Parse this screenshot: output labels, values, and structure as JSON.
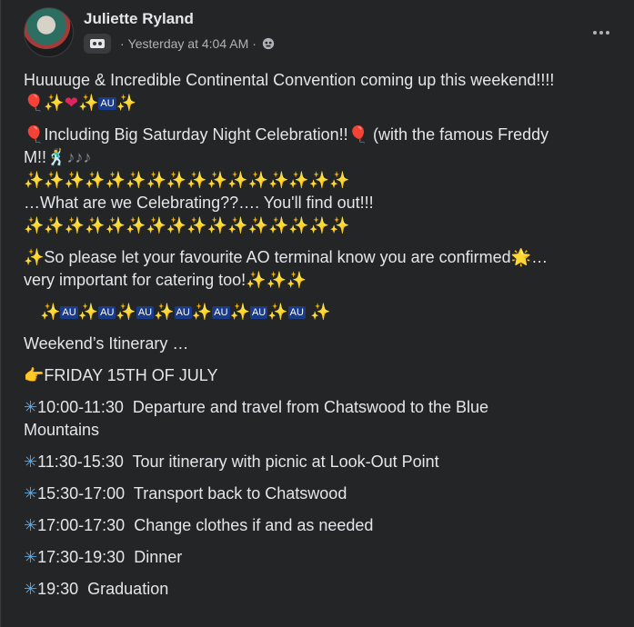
{
  "post": {
    "author": "Juliette Ryland",
    "timestamp": "Yesterday at 4:04 AM",
    "separator": "·",
    "more_label": "•••"
  },
  "icons": {
    "group": "group-icon",
    "globe": "globe-icon",
    "more": "more-options-icon",
    "balloon": "🎈",
    "sparkles": "✨",
    "heart": "❤",
    "flag": "🇦🇺",
    "music": "♪",
    "star": "🌟",
    "point": "👉",
    "snow": "✳",
    "dancer": "🕺"
  },
  "content": {
    "line1": "Huuuuge & Incredible Continental Convention coming up this weekend!!!!",
    "line3_a": "Including Big Saturday Night Celebration!!",
    "line3_b": " (with the famous Freddy",
    "line4": "M!!",
    "line6": "…What are we Celebrating??…. You'll find out!!!",
    "line8_a": "So please let your favourite AO terminal know you are confirmed",
    "line8_b": "…",
    "line9": "very important for catering too!",
    "line11": "Weekend’s Itinerary …",
    "line12": "FRIDAY 15TH OF JULY",
    "itinerary": [
      {
        "time": "10:00-11:30",
        "text": "Departure and travel from Chatswood to the Blue"
      },
      {
        "time": "",
        "text": "Mountains"
      },
      {
        "time": "11:30-15:30",
        "text": "Tour itinerary with picnic at Look-Out Point"
      },
      {
        "time": "15:30-17:00",
        "text": "Transport back to Chatswood"
      },
      {
        "time": "17:00-17:30",
        "text": "Change clothes if and as needed"
      },
      {
        "time": "17:30-19:30",
        "text": "Dinner"
      },
      {
        "time": "19:30",
        "text": "Graduation"
      }
    ]
  },
  "colors": {
    "background": "#242526",
    "text": "#e4e6eb",
    "secondary": "#b0b3b8"
  }
}
